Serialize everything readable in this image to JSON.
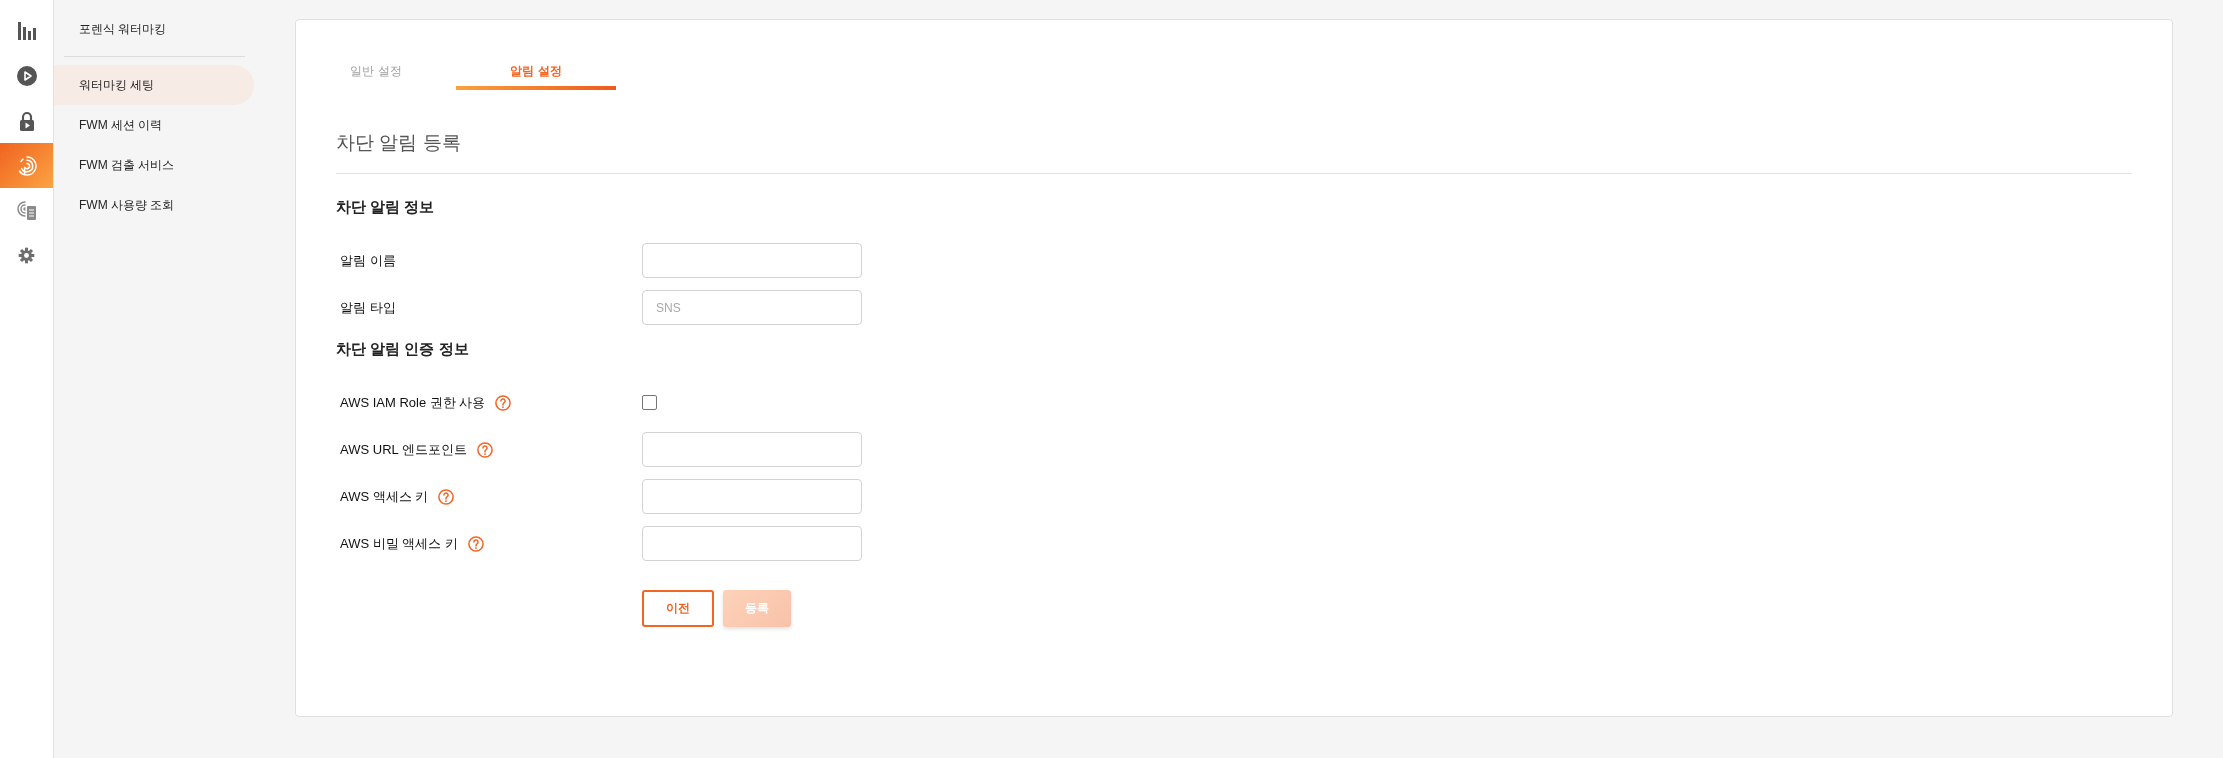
{
  "rail": [
    {
      "selected": false
    },
    {
      "selected": false
    },
    {
      "selected": false
    },
    {
      "selected": true
    },
    {
      "selected": false
    },
    {
      "selected": false
    }
  ],
  "sidebar": {
    "title": "포렌식 워터마킹",
    "items": [
      {
        "label": "워터마킹 세팅",
        "selected": true
      },
      {
        "label": "FWM 세션 이력",
        "selected": false
      },
      {
        "label": "FWM 검출 서비스",
        "selected": false
      },
      {
        "label": "FWM 사용량 조회",
        "selected": false
      }
    ]
  },
  "tabs": [
    {
      "label": "일반 설정",
      "selected": false
    },
    {
      "label": "알림 설정",
      "selected": true
    }
  ],
  "form": {
    "title": "차단 알림 등록",
    "sections": [
      {
        "heading": "차단 알림 정보",
        "rows": [
          {
            "label": "알림 이름",
            "kind": "input",
            "help": false
          },
          {
            "label": "알림 타입",
            "kind": "input",
            "help": false,
            "placeholder": "SNS"
          }
        ]
      },
      {
        "heading": "차단 알림 인증 정보",
        "rows": [
          {
            "label": "AWS IAM Role 권한 사용",
            "kind": "checkbox",
            "help": true,
            "checked": false
          },
          {
            "label": "AWS URL 엔드포인트",
            "kind": "input",
            "help": true
          },
          {
            "label": "AWS 액세스 키",
            "kind": "input",
            "help": true
          },
          {
            "label": "AWS 비밀 액세스 키",
            "kind": "input",
            "help": true
          }
        ]
      }
    ],
    "buttons": [
      {
        "label": "이전",
        "kind": "outline",
        "disabled": false
      },
      {
        "label": "등록",
        "kind": "filled",
        "disabled": true
      }
    ]
  }
}
